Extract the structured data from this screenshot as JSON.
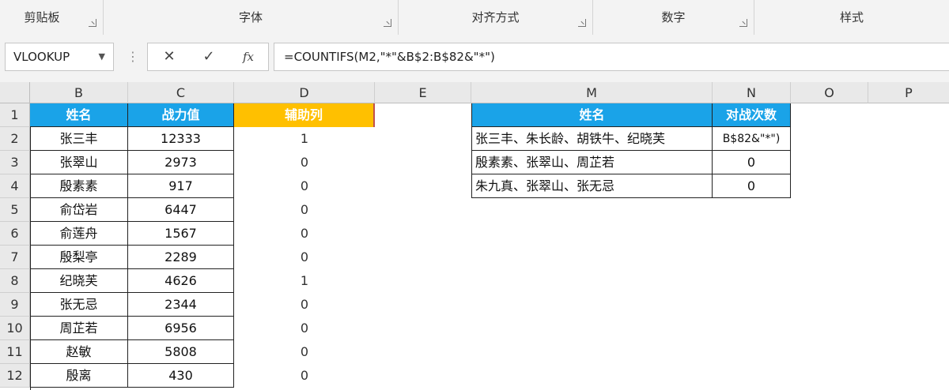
{
  "ribbon": {
    "groups": [
      "剪贴板",
      "字体",
      "对齐方式",
      "数字",
      "样式"
    ]
  },
  "formula_bar": {
    "name_box": "VLOOKUP",
    "cancel_glyph": "✕",
    "confirm_glyph": "✓",
    "fx_label": "fx",
    "formula": "=COUNTIFS(M2,\"*\"&B$2:B$82&\"*\")"
  },
  "columns": [
    "B",
    "C",
    "D",
    "E",
    "M",
    "N",
    "O",
    "P"
  ],
  "rows": [
    "1",
    "2",
    "3",
    "4",
    "5",
    "6",
    "7",
    "8",
    "9",
    "10",
    "11",
    "12"
  ],
  "table1": {
    "headers": [
      "姓名",
      "战力值",
      "辅助列"
    ],
    "rows": [
      {
        "name": "张三丰",
        "power": "12333",
        "helper": "1"
      },
      {
        "name": "张翠山",
        "power": "2973",
        "helper": "0"
      },
      {
        "name": "殷素素",
        "power": "917",
        "helper": "0"
      },
      {
        "name": "俞岱岩",
        "power": "6447",
        "helper": "0"
      },
      {
        "name": "俞莲舟",
        "power": "1567",
        "helper": "0"
      },
      {
        "name": "殷梨亭",
        "power": "2289",
        "helper": "0"
      },
      {
        "name": "纪晓芙",
        "power": "4626",
        "helper": "1"
      },
      {
        "name": "张无忌",
        "power": "2344",
        "helper": "0"
      },
      {
        "name": "周芷若",
        "power": "6956",
        "helper": "0"
      },
      {
        "name": "赵敏",
        "power": "5808",
        "helper": "0"
      },
      {
        "name": "殷离",
        "power": "430",
        "helper": "0"
      }
    ]
  },
  "table2": {
    "headers": [
      "姓名",
      "对战次数"
    ],
    "rows": [
      {
        "names": "张三丰、朱长龄、胡铁牛、纪晓芙",
        "count": "B$82&\"*\")"
      },
      {
        "names": "殷素素、张翠山、周芷若",
        "count": "0"
      },
      {
        "names": "朱九真、张翠山、张无忌",
        "count": "0"
      }
    ]
  },
  "colors": {
    "header_blue": "#1aa3e8",
    "header_orange": "#ffc000"
  }
}
